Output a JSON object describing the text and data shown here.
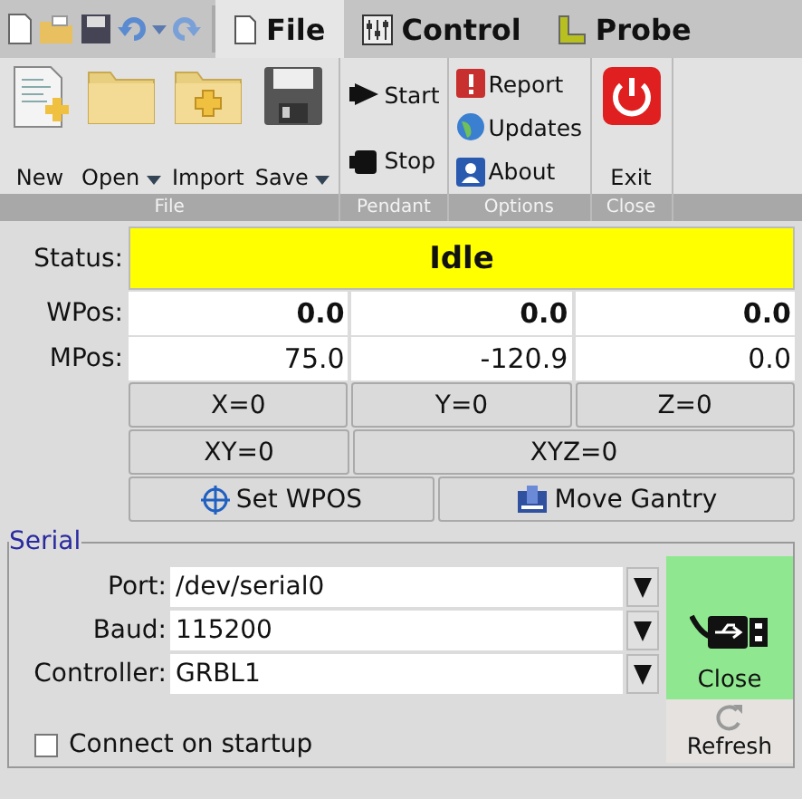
{
  "tabs": [
    {
      "label": "File",
      "selected": true
    },
    {
      "label": "Control",
      "selected": false
    },
    {
      "label": "Probe",
      "selected": false
    }
  ],
  "ribbon": [
    {
      "label": "File",
      "kind": "large",
      "buttons": [
        {
          "label": "New",
          "dropdown": false
        },
        {
          "label": "Open",
          "dropdown": true
        },
        {
          "label": "Import",
          "dropdown": false
        },
        {
          "label": "Save",
          "dropdown": true
        }
      ]
    },
    {
      "label": "Pendant",
      "kind": "small",
      "buttons": [
        {
          "label": "Start"
        },
        {
          "label": "Stop"
        }
      ]
    },
    {
      "label": "Options",
      "kind": "small",
      "buttons": [
        {
          "label": "Report"
        },
        {
          "label": "Updates"
        },
        {
          "label": "About"
        }
      ]
    },
    {
      "label": "Close",
      "kind": "large",
      "buttons": [
        {
          "label": "Exit",
          "dropdown": false
        }
      ]
    }
  ],
  "status": {
    "label": "Status:",
    "value": "Idle"
  },
  "positions": [
    {
      "label": "WPos:",
      "bold": true,
      "values": [
        "0.0",
        "0.0",
        "0.0"
      ]
    },
    {
      "label": "MPos:",
      "bold": false,
      "values": [
        "75.0",
        "-120.9",
        "0.0"
      ]
    }
  ],
  "zero_rows": [
    {
      "kind": "axes",
      "buttons": [
        "X=0",
        "Y=0",
        "Z=0"
      ]
    },
    {
      "kind": "combined",
      "buttons": [
        "XY=0",
        "XYZ=0"
      ]
    },
    {
      "kind": "actions",
      "buttons": [
        "Set WPOS",
        "Move Gantry"
      ]
    }
  ],
  "serial": {
    "title": "Serial",
    "fields": [
      {
        "label": "Port:",
        "value": "/dev/serial0"
      },
      {
        "label": "Baud:",
        "value": "115200"
      },
      {
        "label": "Controller:",
        "value": "GRBL1"
      }
    ],
    "connect_button": {
      "label": "Close",
      "connected": true
    },
    "refresh_button": {
      "label": "Refresh"
    },
    "connect_on_startup": {
      "label": "Connect on startup",
      "checked": false
    }
  }
}
